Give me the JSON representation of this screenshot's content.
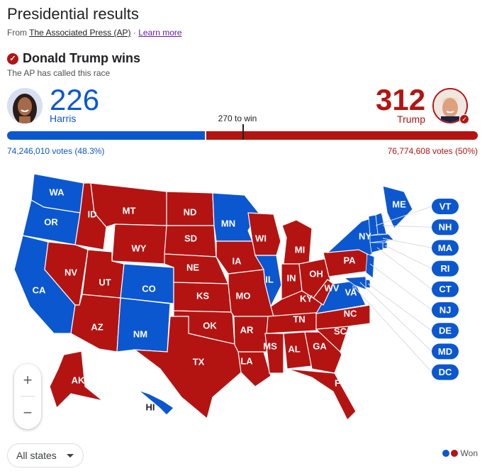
{
  "header": {
    "title": "Presidential results",
    "from": "From",
    "source_link": "The Associated Press (AP)",
    "separator": "·",
    "learn_more": "Learn more"
  },
  "result": {
    "winner_text": "Donald Trump wins",
    "called_text": "The AP has called this race"
  },
  "candidates": {
    "harris": {
      "name": "Harris",
      "electoral": "226",
      "votes": "74,246,010 votes (48.3%)",
      "color": "#0b57d0"
    },
    "trump": {
      "name": "Trump",
      "electoral": "312",
      "votes": "76,774,608 votes (50%)",
      "color": "#b31412"
    }
  },
  "threshold": {
    "label": "270 to win",
    "value": 270,
    "total": 538
  },
  "map": {
    "colors": {
      "D": "#0b57d0",
      "R": "#b31412"
    },
    "states": [
      {
        "abbr": "WA",
        "winner": "D"
      },
      {
        "abbr": "OR",
        "winner": "D"
      },
      {
        "abbr": "CA",
        "winner": "D"
      },
      {
        "abbr": "NV",
        "winner": "R"
      },
      {
        "abbr": "ID",
        "winner": "R"
      },
      {
        "abbr": "MT",
        "winner": "R"
      },
      {
        "abbr": "WY",
        "winner": "R"
      },
      {
        "abbr": "UT",
        "winner": "R"
      },
      {
        "abbr": "AZ",
        "winner": "R"
      },
      {
        "abbr": "CO",
        "winner": "D"
      },
      {
        "abbr": "NM",
        "winner": "D"
      },
      {
        "abbr": "ND",
        "winner": "R"
      },
      {
        "abbr": "SD",
        "winner": "R"
      },
      {
        "abbr": "NE",
        "winner": "R"
      },
      {
        "abbr": "KS",
        "winner": "R"
      },
      {
        "abbr": "OK",
        "winner": "R"
      },
      {
        "abbr": "TX",
        "winner": "R"
      },
      {
        "abbr": "MN",
        "winner": "D"
      },
      {
        "abbr": "IA",
        "winner": "R"
      },
      {
        "abbr": "MO",
        "winner": "R"
      },
      {
        "abbr": "AR",
        "winner": "R"
      },
      {
        "abbr": "LA",
        "winner": "R"
      },
      {
        "abbr": "WI",
        "winner": "R"
      },
      {
        "abbr": "IL",
        "winner": "D"
      },
      {
        "abbr": "MI",
        "winner": "R"
      },
      {
        "abbr": "IN",
        "winner": "R"
      },
      {
        "abbr": "OH",
        "winner": "R"
      },
      {
        "abbr": "KY",
        "winner": "R"
      },
      {
        "abbr": "TN",
        "winner": "R"
      },
      {
        "abbr": "MS",
        "winner": "R"
      },
      {
        "abbr": "AL",
        "winner": "R"
      },
      {
        "abbr": "GA",
        "winner": "R"
      },
      {
        "abbr": "FL",
        "winner": "R"
      },
      {
        "abbr": "SC",
        "winner": "R"
      },
      {
        "abbr": "NC",
        "winner": "R"
      },
      {
        "abbr": "VA",
        "winner": "D"
      },
      {
        "abbr": "WV",
        "winner": "R"
      },
      {
        "abbr": "PA",
        "winner": "R"
      },
      {
        "abbr": "NY",
        "winner": "D"
      },
      {
        "abbr": "ME",
        "winner": "D"
      },
      {
        "abbr": "AK",
        "winner": "R"
      },
      {
        "abbr": "HI",
        "winner": "D"
      }
    ],
    "small_states": [
      {
        "abbr": "VT",
        "winner": "D"
      },
      {
        "abbr": "NH",
        "winner": "D"
      },
      {
        "abbr": "MA",
        "winner": "D"
      },
      {
        "abbr": "RI",
        "winner": "D"
      },
      {
        "abbr": "CT",
        "winner": "D"
      },
      {
        "abbr": "NJ",
        "winner": "D"
      },
      {
        "abbr": "DE",
        "winner": "D"
      },
      {
        "abbr": "MD",
        "winner": "D"
      },
      {
        "abbr": "DC",
        "winner": "D"
      }
    ]
  },
  "controls": {
    "zoom_in": "+",
    "zoom_out": "−",
    "filter": "All states"
  },
  "legend": {
    "label": "Won"
  }
}
